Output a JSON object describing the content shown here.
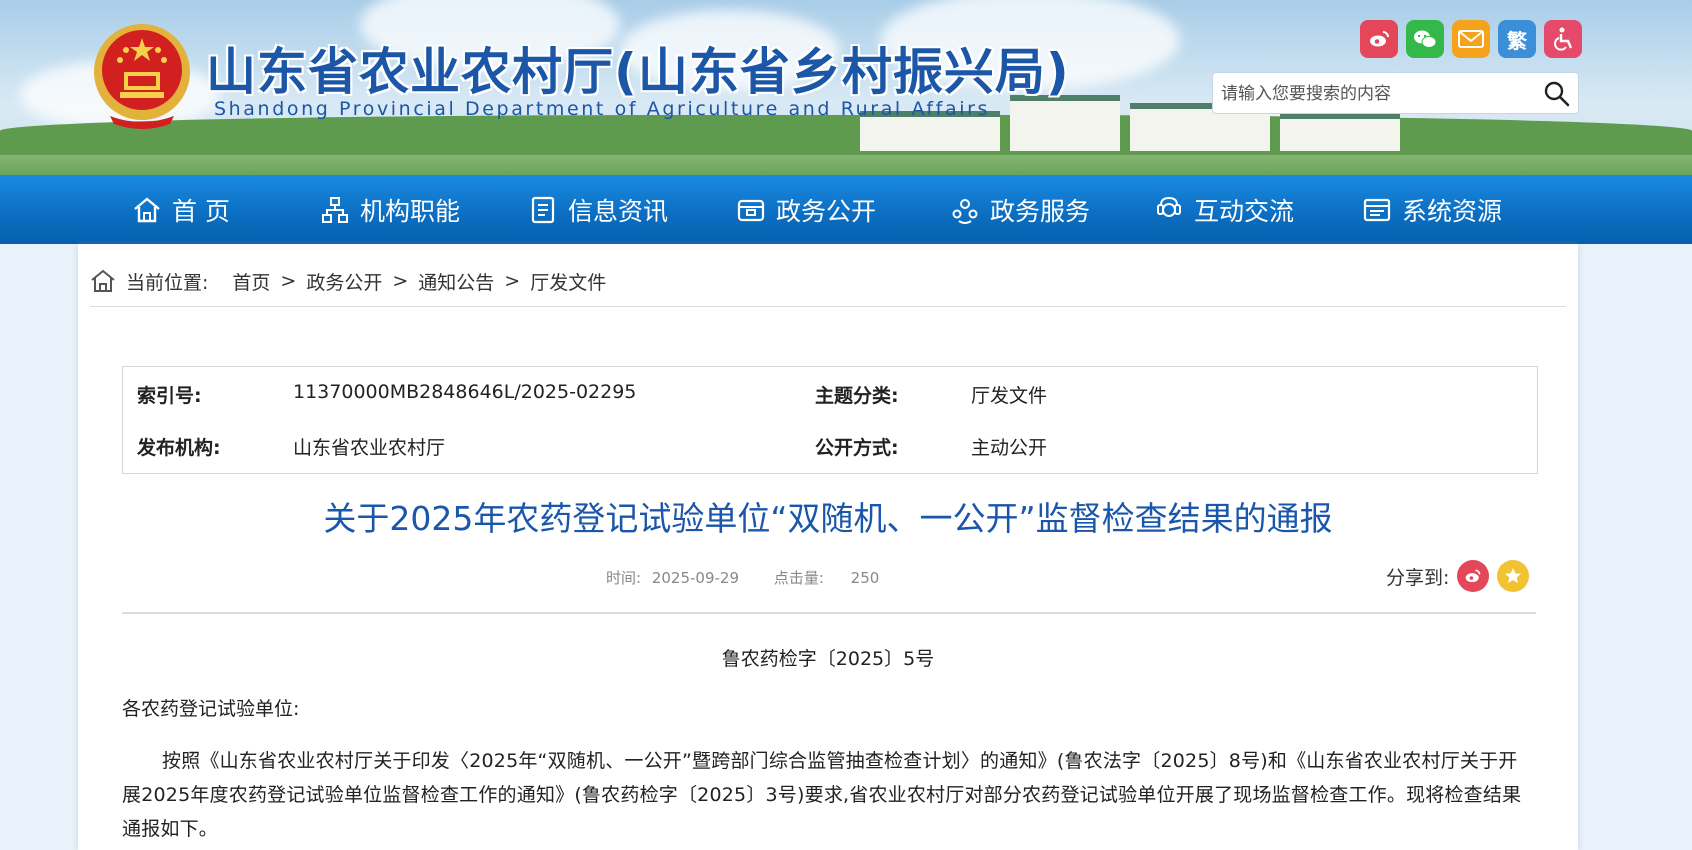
{
  "header": {
    "title": "山东省农业农村厅(山东省乡村振兴局)",
    "subtitle": "Shandong Provincial Department of Agriculture and Rural Affairs",
    "social_icons": [
      "weibo-icon",
      "wechat-icon",
      "email-icon",
      "traditional-chinese-icon",
      "accessibility-icon"
    ],
    "traditional_label": "繁",
    "search_placeholder": "请输入您要搜索的内容"
  },
  "nav": {
    "items": [
      {
        "label": "首 页",
        "icon": "home-icon"
      },
      {
        "label": "机构职能",
        "icon": "org-chart-icon"
      },
      {
        "label": "信息资讯",
        "icon": "news-icon"
      },
      {
        "label": "政务公开",
        "icon": "box-icon"
      },
      {
        "label": "政务服务",
        "icon": "service-icon"
      },
      {
        "label": "互动交流",
        "icon": "interaction-icon"
      },
      {
        "label": "系统资源",
        "icon": "resource-icon"
      }
    ]
  },
  "breadcrumb": {
    "prefix": "当前位置:",
    "items": [
      "首页",
      "政务公开",
      "通知公告",
      "厅发文件"
    ],
    "separator": ">"
  },
  "meta": {
    "index_label": "索引号:",
    "index_value": "11370000MB2848646L/2025-02295",
    "topic_label": "主题分类:",
    "topic_value": "厅发文件",
    "publisher_label": "发布机构:",
    "publisher_value": "山东省农业农村厅",
    "disclosure_label": "公开方式:",
    "disclosure_value": "主动公开"
  },
  "article": {
    "title": "关于2025年农药登记试验单位“双随机、一公开”监督检查结果的通报",
    "time_label": "时间:",
    "time_value": "2025-09-29",
    "clicks_label": "点击量:",
    "clicks_value": "250",
    "share_label": "分享到:",
    "doc_number": "鲁农药检字〔2025〕5号",
    "salutation": "各农药登记试验单位:",
    "paragraph": "按照《山东省农业农村厅关于印发〈2025年“双随机、一公开”暨跨部门综合监管抽查检查计划〉的通知》(鲁农法字〔2025〕8号)和《山东省农业农村厅关于开展2025年度农药登记试验单位监督检查工作的通知》(鲁农药检字〔2025〕3号)要求,省农业农村厅对部分农药登记试验单位开展了现场监督检查工作。现将检查结果通报如下。"
  },
  "colors": {
    "brand_blue": "#1b56a7",
    "nav_blue": "#0c6fc3",
    "weibo_red": "#e4465a",
    "wechat_green": "#35b84a",
    "email_orange": "#f5a31c",
    "traditional_blue": "#3b8fd9",
    "accessibility_pink": "#e54a6a",
    "favorite_yellow": "#f1c232"
  }
}
